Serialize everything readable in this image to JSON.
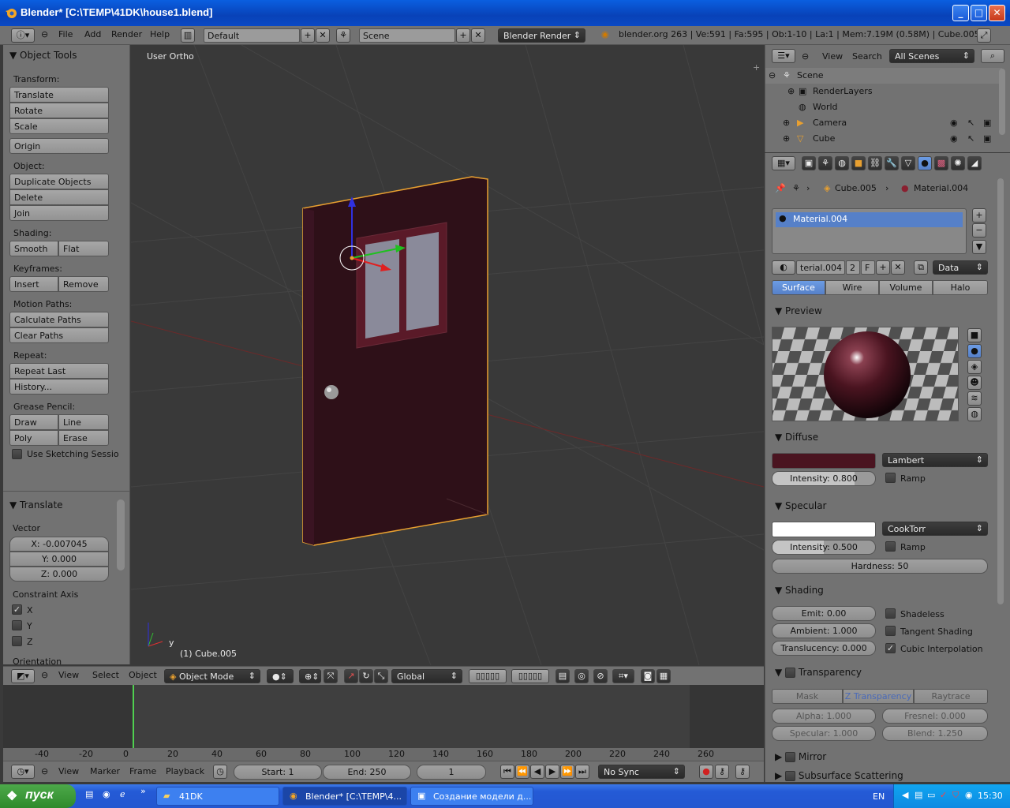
{
  "window": {
    "title": "Blender* [C:\\TEMP\\41DK\\house1.blend]",
    "minimize": "_",
    "maximize": "□",
    "close": "✕"
  },
  "infobar": {
    "menus": [
      "File",
      "Add",
      "Render",
      "Help"
    ],
    "layout": "Default",
    "scene": "Scene",
    "engine": "Blender Render",
    "stats": "blender.org 263 | Ve:591 | Fa:595 | Ob:1-10 | La:1 | Mem:7.19M (0.58M) | Cube.005"
  },
  "toolshelf": {
    "title": "Object Tools",
    "transform_label": "Transform:",
    "translate": "Translate",
    "rotate": "Rotate",
    "scale": "Scale",
    "origin": "Origin",
    "object_label": "Object:",
    "duplicate": "Duplicate Objects",
    "delete": "Delete",
    "join": "Join",
    "shading_label": "Shading:",
    "smooth": "Smooth",
    "flat": "Flat",
    "keyframes_label": "Keyframes:",
    "insert": "Insert",
    "remove": "Remove",
    "motion_label": "Motion Paths:",
    "calc_paths": "Calculate Paths",
    "clear_paths": "Clear Paths",
    "repeat_label": "Repeat:",
    "repeat_last": "Repeat Last",
    "history": "History...",
    "grease_label": "Grease Pencil:",
    "draw": "Draw",
    "line": "Line",
    "poly": "Poly",
    "erase": "Erase",
    "sketching": "Use Sketching Sessio"
  },
  "operator": {
    "title": "Translate",
    "vector_label": "Vector",
    "x": "X: -0.007045",
    "y": "Y: 0.000",
    "z": "Z: 0.000",
    "constraint_label": "Constraint Axis",
    "cx": "X",
    "cy": "Y",
    "cz": "Z",
    "orientation_label": "Orientation"
  },
  "viewport": {
    "view_name": "User Ortho",
    "object_name": "(1) Cube.005"
  },
  "viewhdr": {
    "view": "View",
    "select": "Select",
    "object": "Object",
    "mode": "Object Mode",
    "orientation": "Global"
  },
  "timeline": {
    "ticks": [
      "-40",
      "-20",
      "0",
      "20",
      "40",
      "60",
      "80",
      "100",
      "120",
      "140",
      "160",
      "180",
      "200",
      "220",
      "240",
      "260"
    ],
    "current_frame_marker": 1
  },
  "timehdr": {
    "view": "View",
    "marker": "Marker",
    "frame": "Frame",
    "playback": "Playback",
    "start": "Start: 1",
    "end": "End: 250",
    "current": "1",
    "sync": "No Sync"
  },
  "outliner": {
    "view": "View",
    "search": "Search",
    "filter": "All Scenes",
    "items": [
      "Scene",
      "RenderLayers",
      "World",
      "Camera",
      "Cube"
    ]
  },
  "properties": {
    "breadcrumb_object": "Cube.005",
    "breadcrumb_material": "Material.004",
    "slot": "Material.004",
    "material_name": "terial.004",
    "users": "2",
    "fake": "F",
    "link": "Data",
    "tabs": [
      "Surface",
      "Wire",
      "Volume",
      "Halo"
    ],
    "preview_title": "Preview",
    "diffuse_title": "Diffuse",
    "diffuse_color": "#4a1420",
    "diffuse_shader": "Lambert",
    "diffuse_intensity": "Intensity: 0.800",
    "diffuse_intensity_value": 0.8,
    "ramp": "Ramp",
    "specular_title": "Specular",
    "specular_color": "#ffffff",
    "specular_shader": "CookTorr",
    "specular_intensity": "Intensity: 0.500",
    "specular_intensity_value": 0.5,
    "hardness": "Hardness: 50",
    "shading_title": "Shading",
    "emit": "Emit: 0.00",
    "ambient": "Ambient: 1.000",
    "translucency": "Translucency: 0.000",
    "shadeless": "Shadeless",
    "tangent": "Tangent Shading",
    "cubic": "Cubic Interpolation",
    "transparency_title": "Transparency",
    "trans_tabs": [
      "Mask",
      "Z Transparency",
      "Raytrace"
    ],
    "alpha": "Alpha: 1.000",
    "fresnel": "Fresnel: 0.000",
    "specular_t": "Specular: 1.000",
    "blend": "Blend: 1.250",
    "mirror_title": "Mirror",
    "sss_title": "Subsurface Scattering"
  },
  "taskbar": {
    "start": "пуск",
    "items": [
      "41DK",
      "Blender* [C:\\TEMP\\4...",
      "Создание модели д..."
    ],
    "lang": "EN",
    "time": "15:30"
  }
}
